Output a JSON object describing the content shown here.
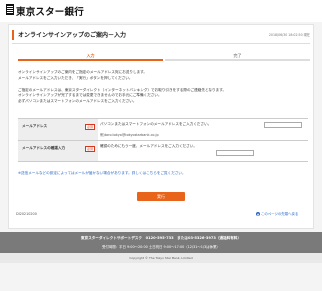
{
  "header": {
    "logo_mark_text": "TOKYO STAR BANK",
    "bank_name": "東京スター銀行"
  },
  "page": {
    "title": "オンラインサインアップのご案内－入力",
    "datetime": "2018/06/30 18:02:50 現在"
  },
  "steps": [
    {
      "label": "入力",
      "active": true
    },
    {
      "label": "完了",
      "active": false
    }
  ],
  "intro": {
    "p1_line1": "オンラインサインアップのご案内をご指定のメールアドレス宛にお送りします。",
    "p1_line2": "メールアドレスをご入力いただき、「実行」ボタンを押してください。",
    "p2_line1": "ご指定のメールアドレスは、東京スターダイレクト（インターネットバンキング）でお取り引きをする際のご連絡先となります。",
    "p2_line2": "オンラインサインアップが完了するまでは変更できませんのでお手元にご準備ください。",
    "p2_line3": "必ずパソコンまたはスマートフォンのメールアドレスをご入力ください。"
  },
  "form": {
    "required_label": "必須",
    "email": {
      "label": "メールアドレス",
      "instruction": "パソコンまたはスマートフォンのメールアドレスをご入力ください。",
      "example": "例)taro.tokyo@tokyostarbank.co.jp",
      "value": ""
    },
    "email_confirm": {
      "label": "メールアドレスの確認入力",
      "instruction": "確認のためにもう一度、メールアドレスをご入力ください。",
      "value": ""
    }
  },
  "note": "※送信メールなどの設定によってはメールが届かない場合があります。詳しくはこちらをご覧ください。",
  "submit_label": "実行",
  "screen_id": "DI20210200",
  "to_top_label": "このページの先頭へ戻る",
  "footer": {
    "line1": "東京スターダイレクトサポートデスク　0120-595-733　または03-5326-3973（通話料有料）",
    "line2": "受付時間：平日 9:00～20:00 土日祝日 9:00～17:00（12/31～1/3は休業）",
    "copyright": "Copyright © The Tokyo Star Bank, Limited"
  },
  "colors": {
    "accent": "#e8641b",
    "link": "#2b67c6",
    "required": "#d9361c",
    "footer_bg": "#7a7a7a"
  }
}
